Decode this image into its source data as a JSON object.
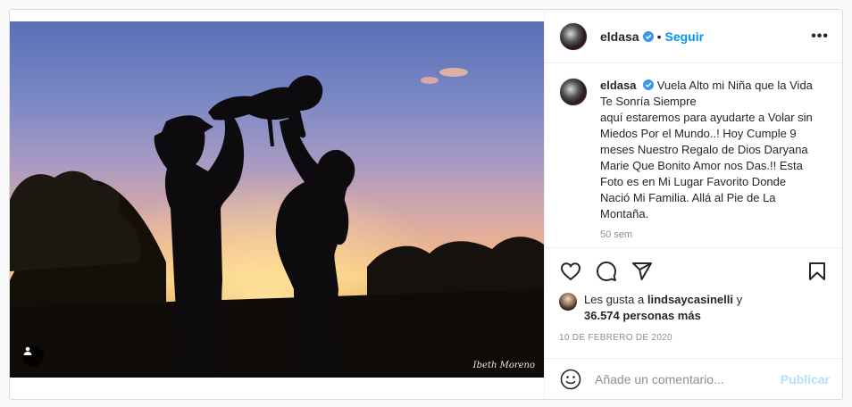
{
  "header": {
    "username": "eldasa",
    "separator": "•",
    "follow_label": "Seguir",
    "more_label": "•••"
  },
  "caption": {
    "username": "eldasa",
    "text_line1": "Vuela Alto mi Niña que la Vida Te Sonría Siempre",
    "text_rest": "aquí estaremos para ayudarte a Volar sin Miedos Por el Mundo..! Hoy Cumple 9 meses Nuestro Regalo de Dios Daryana Marie Que Bonito Amor nos Das.!! Esta Foto es en Mi Lugar Favorito Donde Nació Mi Familia. Allá al Pie de La Montaña.",
    "time_ago": "50 sem"
  },
  "likes": {
    "prefix": "Les gusta a",
    "liker": "lindsaycasinelli",
    "conjunction": "y",
    "others": "36.574 personas más"
  },
  "date": "10 DE FEBRERO DE 2020",
  "comment": {
    "placeholder": "Añade un comentario...",
    "publish_label": "Publicar"
  },
  "media": {
    "watermark": "Ibeth Moreno"
  },
  "icons": {
    "like": "heart-icon",
    "comment": "comment-icon",
    "share": "share-icon",
    "save": "bookmark-icon",
    "emoji": "emoji-icon",
    "tag": "user-tag-icon",
    "verified": "verified-badge-icon"
  },
  "colors": {
    "accent": "#0095f6",
    "publish_disabled": "#b2dffc",
    "muted": "#8e8e8e"
  }
}
